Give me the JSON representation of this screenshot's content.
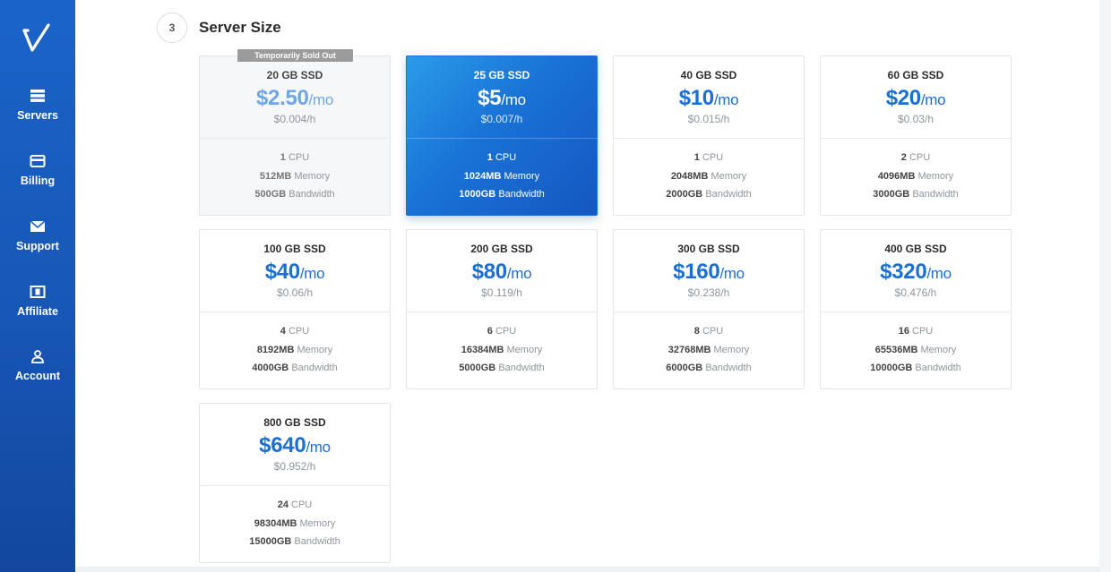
{
  "sidebar": {
    "items": [
      {
        "label": "Servers",
        "icon": "servers-icon"
      },
      {
        "label": "Billing",
        "icon": "credit-card-icon"
      },
      {
        "label": "Support",
        "icon": "envelope-icon"
      },
      {
        "label": "Affiliate",
        "icon": "dollar-bill-icon"
      },
      {
        "label": "Account",
        "icon": "user-icon"
      }
    ]
  },
  "section": {
    "step": "3",
    "title": "Server Size"
  },
  "accent_color": "#1a6fd6",
  "plans": [
    {
      "name": "20 GB SSD",
      "price": "$2.50",
      "period": "/mo",
      "hourly": "$0.004/h",
      "cpu": "1",
      "memory": "512MB",
      "bandwidth": "500GB",
      "badge": "Temporarily Sold Out",
      "state": "sold-out"
    },
    {
      "name": "25 GB SSD",
      "price": "$5",
      "period": "/mo",
      "hourly": "$0.007/h",
      "cpu": "1",
      "memory": "1024MB",
      "bandwidth": "1000GB",
      "state": "selected"
    },
    {
      "name": "40 GB SSD",
      "price": "$10",
      "period": "/mo",
      "hourly": "$0.015/h",
      "cpu": "1",
      "memory": "2048MB",
      "bandwidth": "2000GB",
      "state": "available"
    },
    {
      "name": "60 GB SSD",
      "price": "$20",
      "period": "/mo",
      "hourly": "$0.03/h",
      "cpu": "2",
      "memory": "4096MB",
      "bandwidth": "3000GB",
      "state": "available"
    },
    {
      "name": "100 GB SSD",
      "price": "$40",
      "period": "/mo",
      "hourly": "$0.06/h",
      "cpu": "4",
      "memory": "8192MB",
      "bandwidth": "4000GB",
      "state": "available"
    },
    {
      "name": "200 GB SSD",
      "price": "$80",
      "period": "/mo",
      "hourly": "$0.119/h",
      "cpu": "6",
      "memory": "16384MB",
      "bandwidth": "5000GB",
      "state": "available"
    },
    {
      "name": "300 GB SSD",
      "price": "$160",
      "period": "/mo",
      "hourly": "$0.238/h",
      "cpu": "8",
      "memory": "32768MB",
      "bandwidth": "6000GB",
      "state": "available"
    },
    {
      "name": "400 GB SSD",
      "price": "$320",
      "period": "/mo",
      "hourly": "$0.476/h",
      "cpu": "16",
      "memory": "65536MB",
      "bandwidth": "10000GB",
      "state": "available"
    },
    {
      "name": "800 GB SSD",
      "price": "$640",
      "period": "/mo",
      "hourly": "$0.952/h",
      "cpu": "24",
      "memory": "98304MB",
      "bandwidth": "15000GB",
      "state": "available"
    }
  ],
  "spec_labels": {
    "cpu": "CPU",
    "memory": "Memory",
    "bandwidth": "Bandwidth"
  }
}
